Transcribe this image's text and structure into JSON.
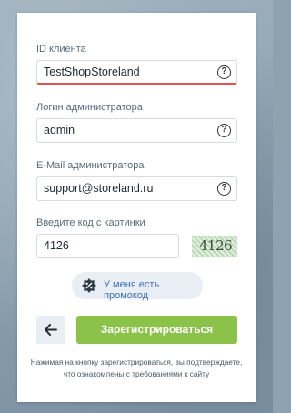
{
  "form": {
    "client_id": {
      "label": "ID клиента",
      "value": "TestShopStoreland",
      "help": "?"
    },
    "admin_login": {
      "label": "Логин администратора",
      "value": "admin",
      "help": "?"
    },
    "admin_email": {
      "label": "E-Mail администратора",
      "value": "support@storeland.ru",
      "help": "?"
    },
    "captcha": {
      "label": "Введите код с картинки",
      "value": "4126",
      "image_text": "4126"
    },
    "promo": {
      "label": "У меня есть промокод",
      "icon": "promo-badge-icon"
    },
    "back_button": {
      "icon": "arrow-left-icon"
    },
    "submit_label": "Зарегистрироваться",
    "agreement": {
      "text": "Нажимая на кнопку зарегистрироваться, вы подтверждаете, что ознакомлены с ",
      "link": "требованиями к сайту"
    }
  },
  "colors": {
    "accent_green": "#8bc34a",
    "link_blue": "#3d72b8",
    "error_red": "#e05252",
    "soft_bg": "#e8eef4"
  }
}
